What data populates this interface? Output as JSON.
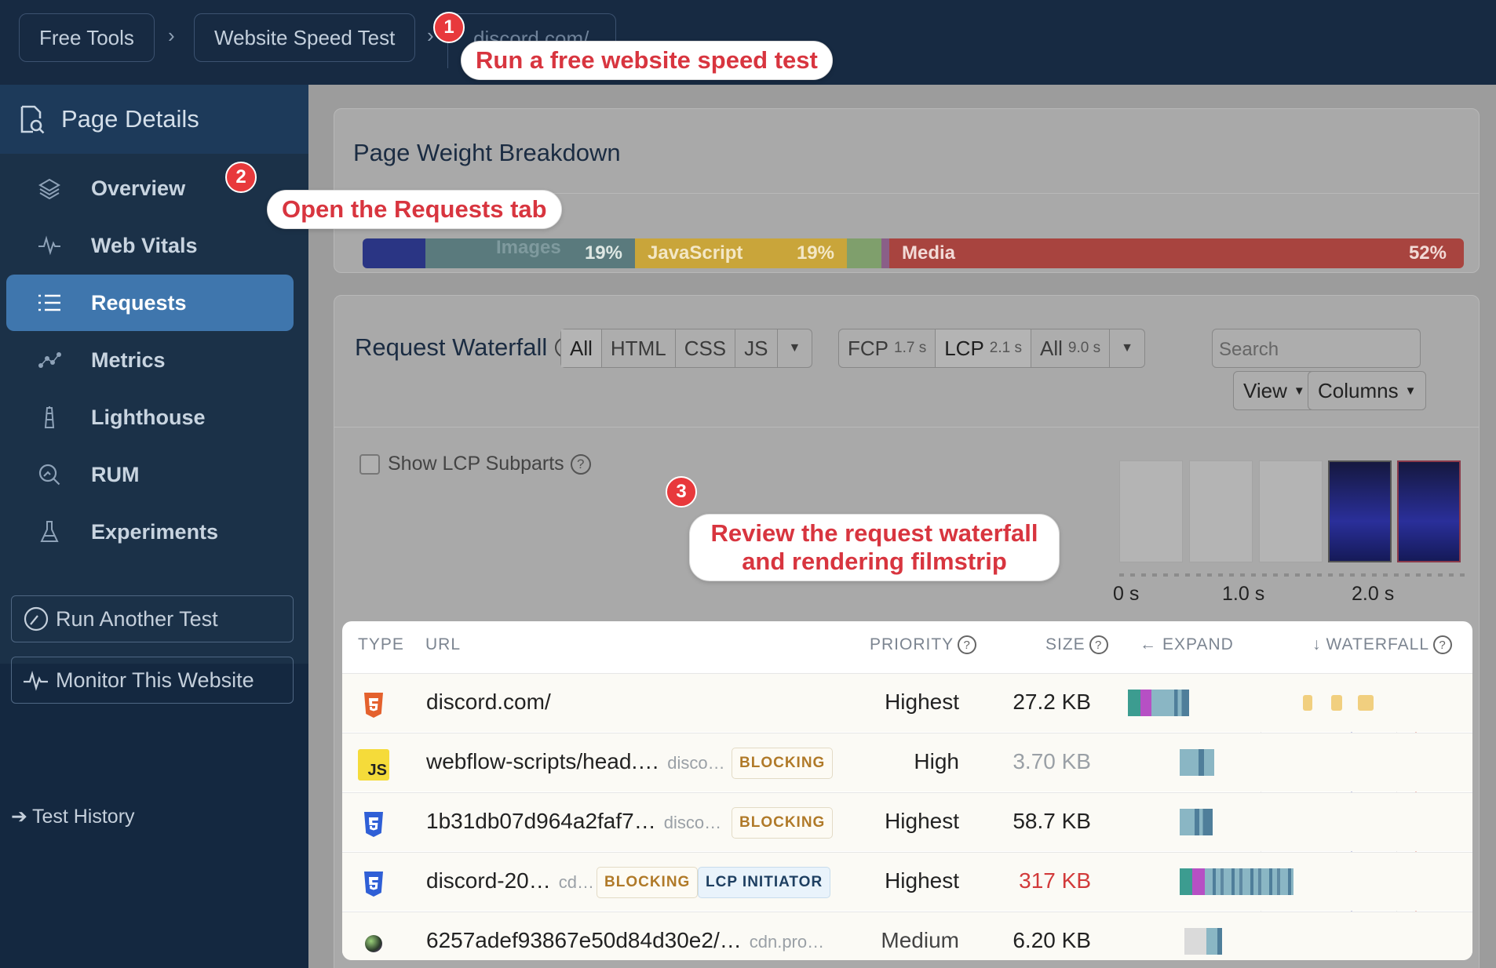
{
  "breadcrumb": {
    "items": [
      "Free Tools",
      "Website Speed Test"
    ],
    "current": "discord.com/",
    "sep": "›"
  },
  "sidebar": {
    "title": "Page Details",
    "items": [
      {
        "label": "Overview",
        "icon": "layers-icon"
      },
      {
        "label": "Web Vitals",
        "icon": "pulse-icon"
      },
      {
        "label": "Requests",
        "icon": "list-icon",
        "active": true
      },
      {
        "label": "Metrics",
        "icon": "scatter-icon"
      },
      {
        "label": "Lighthouse",
        "icon": "lighthouse-icon"
      },
      {
        "label": "RUM",
        "icon": "gauge-search-icon"
      },
      {
        "label": "Experiments",
        "icon": "flask-icon"
      }
    ],
    "run_button": "Run Another Test",
    "monitor_button": "Monitor This Website",
    "history_link": "Test History"
  },
  "page_weight": {
    "title": "Page Weight Breakdown",
    "segments": [
      {
        "label": "Images",
        "pct": "19%",
        "color": "#5a7a7d"
      },
      {
        "label": "JavaScript",
        "pct": "19%",
        "color": "#c9a53a"
      },
      {
        "label": "Media",
        "pct": "52%",
        "color": "#a8443f"
      }
    ]
  },
  "waterfall": {
    "title": "Request Waterfall",
    "filters": [
      "All",
      "HTML",
      "CSS",
      "JS"
    ],
    "milestones": [
      {
        "label": "FCP",
        "time": "1.7 s"
      },
      {
        "label": "LCP",
        "time": "2.1 s"
      },
      {
        "label": "All",
        "time": "9.0 s"
      }
    ],
    "search_placeholder": "Search",
    "view_label": "View",
    "columns_label": "Columns",
    "lcp_checkbox": "Show LCP Subparts",
    "ticks": [
      "0 s",
      "1.0 s",
      "2.0 s"
    ],
    "headers": {
      "type": "TYPE",
      "url": "URL",
      "priority": "PRIORITY",
      "size": "SIZE",
      "expand": "EXPAND",
      "waterfall": "WATERFALL"
    },
    "rows": [
      {
        "url": "discord.com/",
        "domain": "",
        "badges": [],
        "priority": "Highest",
        "size": "27.2 KB",
        "type": "html"
      },
      {
        "url": "webflow-scripts/head.…",
        "domain": "disco…",
        "badges": [
          "BLOCKING"
        ],
        "priority": "High",
        "size": "3.70 KB",
        "type": "js"
      },
      {
        "url": "1b31db07d964a2faf7…",
        "domain": "disco…",
        "badges": [
          "BLOCKING"
        ],
        "priority": "Highest",
        "size": "58.7 KB",
        "type": "css"
      },
      {
        "url": "discord-20…",
        "domain": "cd…",
        "badges": [
          "BLOCKING",
          "LCP INITIATOR"
        ],
        "priority": "Highest",
        "size": "317 KB",
        "type": "css"
      },
      {
        "url": "6257adef93867e50d84d30e2/…",
        "domain": "cdn.pro…",
        "badges": [],
        "priority": "Medium",
        "size": "6.20 KB",
        "type": "image"
      }
    ]
  },
  "annotations": [
    {
      "num": "1",
      "text": "Run a free website speed test"
    },
    {
      "num": "2",
      "text": "Open the Requests tab"
    },
    {
      "num": "3",
      "text": "Review the request waterfall\nand rendering filmstrip"
    }
  ]
}
